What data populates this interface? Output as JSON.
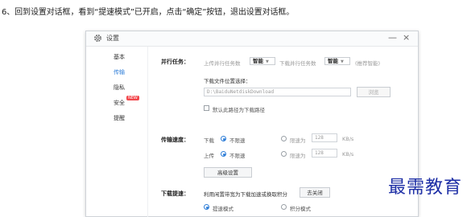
{
  "instruction": "6、回到设置对话框，看到“提速模式”已开启，点击“确定”按钮，退出设置对话框。",
  "dialog": {
    "title": "设置",
    "minimize": "—",
    "close": "×"
  },
  "sidebar": {
    "items": [
      {
        "label": "基本",
        "active": false
      },
      {
        "label": "传输",
        "active": true
      },
      {
        "label": "隐私",
        "active": false
      },
      {
        "label": "安全",
        "active": false,
        "badge": "NEW"
      },
      {
        "label": "提醒",
        "active": false
      }
    ]
  },
  "transfer": {
    "parallel_label": "并行任务：",
    "upload_parallel_label": "上传并行任务数",
    "upload_parallel_value": "智能",
    "download_parallel_label": "下载并行任务数",
    "download_parallel_value": "智能",
    "recommend": "(推荐智能)",
    "download_path_label": "下载文件位置选择：",
    "download_path_value": "D:\\BaiduNetdiskDownload",
    "browse_button": "浏览",
    "default_path_checkbox": "默认此路径为下载路径",
    "default_path_checked": false
  },
  "speed": {
    "label": "传输速度：",
    "download_label": "下载",
    "upload_label": "上传",
    "unlimited": "不限速",
    "limit": "限速为",
    "download_limit_value": "128",
    "upload_limit_value": "128",
    "unit": "KB/s",
    "download_mode": "unlimited",
    "upload_mode": "unlimited",
    "advanced_button": "高级设置"
  },
  "boost": {
    "label": "下载提速：",
    "text": "利用闲置带宽为下载加速或换取积分",
    "close_button": "去关闭",
    "option_speed": "提速模式",
    "option_points": "积分模式",
    "selected": "speed"
  },
  "watermark": "最需教育",
  "colors": {
    "accent": "#2f7ed8",
    "badge": "#f2464b",
    "watermark": "#1e2fa6"
  }
}
